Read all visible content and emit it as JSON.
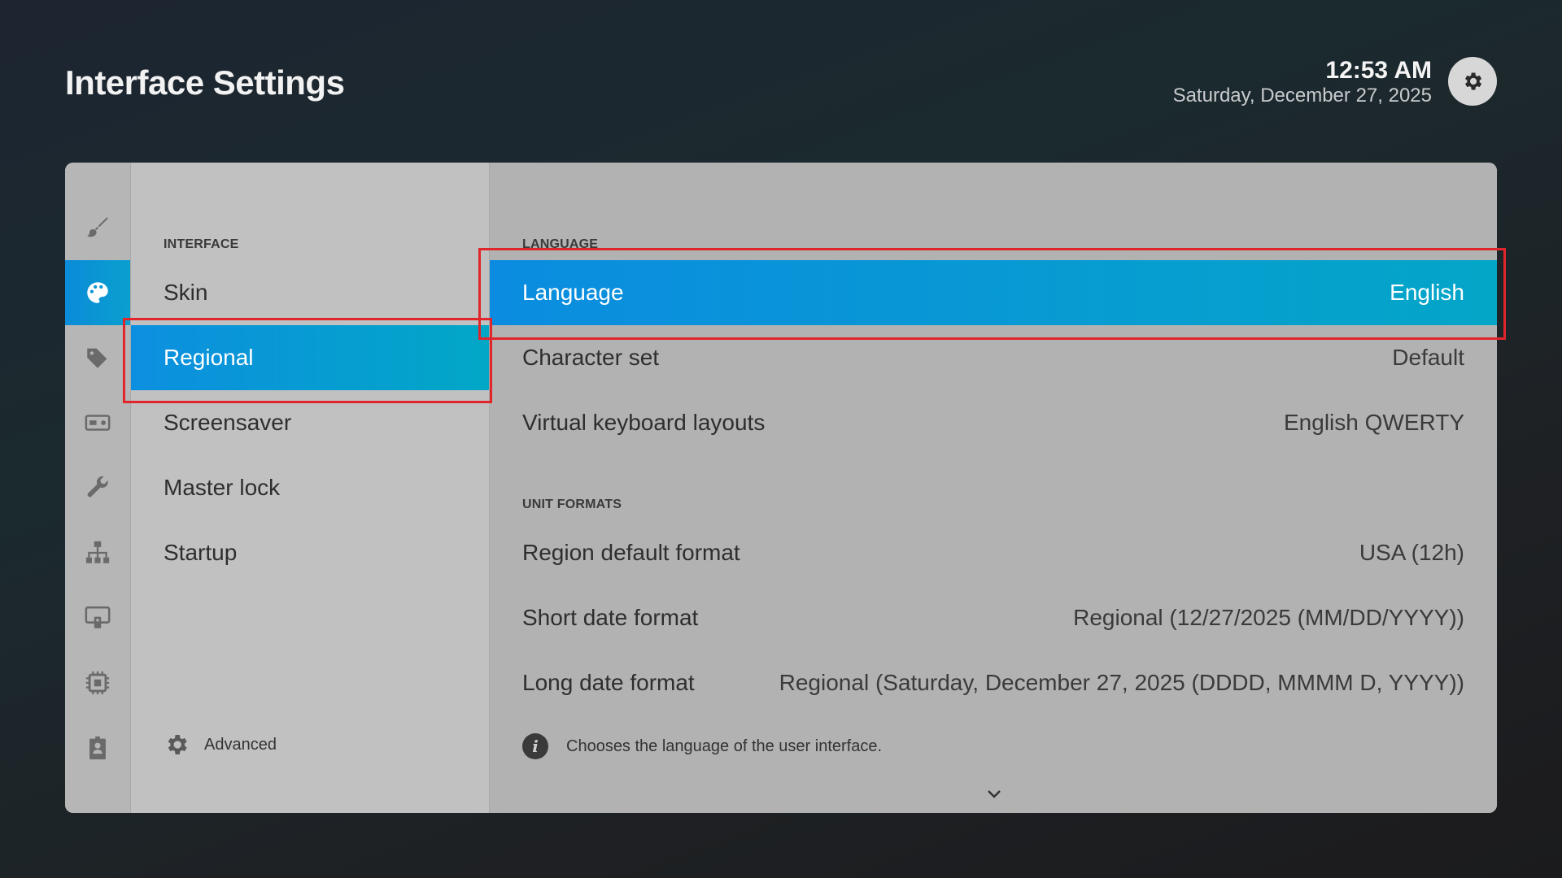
{
  "header": {
    "title": "Interface Settings",
    "time": "12:53 AM",
    "date": "Saturday, December 27, 2025"
  },
  "icon_bar": [
    {
      "icon": "brush-icon",
      "active": false
    },
    {
      "icon": "palette-icon",
      "active": true
    },
    {
      "icon": "tags-icon",
      "active": false
    },
    {
      "icon": "player-icon",
      "active": false
    },
    {
      "icon": "wrench-icon",
      "active": false
    },
    {
      "icon": "network-icon",
      "active": false
    },
    {
      "icon": "remote-display-icon",
      "active": false
    },
    {
      "icon": "chip-icon",
      "active": false
    },
    {
      "icon": "id-badge-icon",
      "active": false
    }
  ],
  "menu": {
    "section": "INTERFACE",
    "items": [
      {
        "label": "Skin",
        "active": false
      },
      {
        "label": "Regional",
        "active": true
      },
      {
        "label": "Screensaver",
        "active": false
      },
      {
        "label": "Master lock",
        "active": false
      },
      {
        "label": "Startup",
        "active": false
      }
    ],
    "advanced_label": "Advanced"
  },
  "content": {
    "language_section": "LANGUAGE",
    "language_rows": [
      {
        "label": "Language",
        "value": "English",
        "active": true
      },
      {
        "label": "Character set",
        "value": "Default",
        "active": false
      },
      {
        "label": "Virtual keyboard layouts",
        "value": "English QWERTY",
        "active": false
      }
    ],
    "unit_section": "UNIT FORMATS",
    "unit_rows": [
      {
        "label": "Region default format",
        "value": "USA (12h)"
      },
      {
        "label": "Short date format",
        "value": "Regional (12/27/2025 (MM/DD/YYYY))"
      },
      {
        "label": "Long date format",
        "value": "Regional (Saturday, December 27, 2025 (DDDD, MMMM D, YYYY))"
      }
    ],
    "info_text": "Chooses the language of the user interface."
  },
  "colors": {
    "accent_start": "#0c8fe0",
    "accent_end": "#02a7c6",
    "focus_outline": "#e0252b"
  }
}
